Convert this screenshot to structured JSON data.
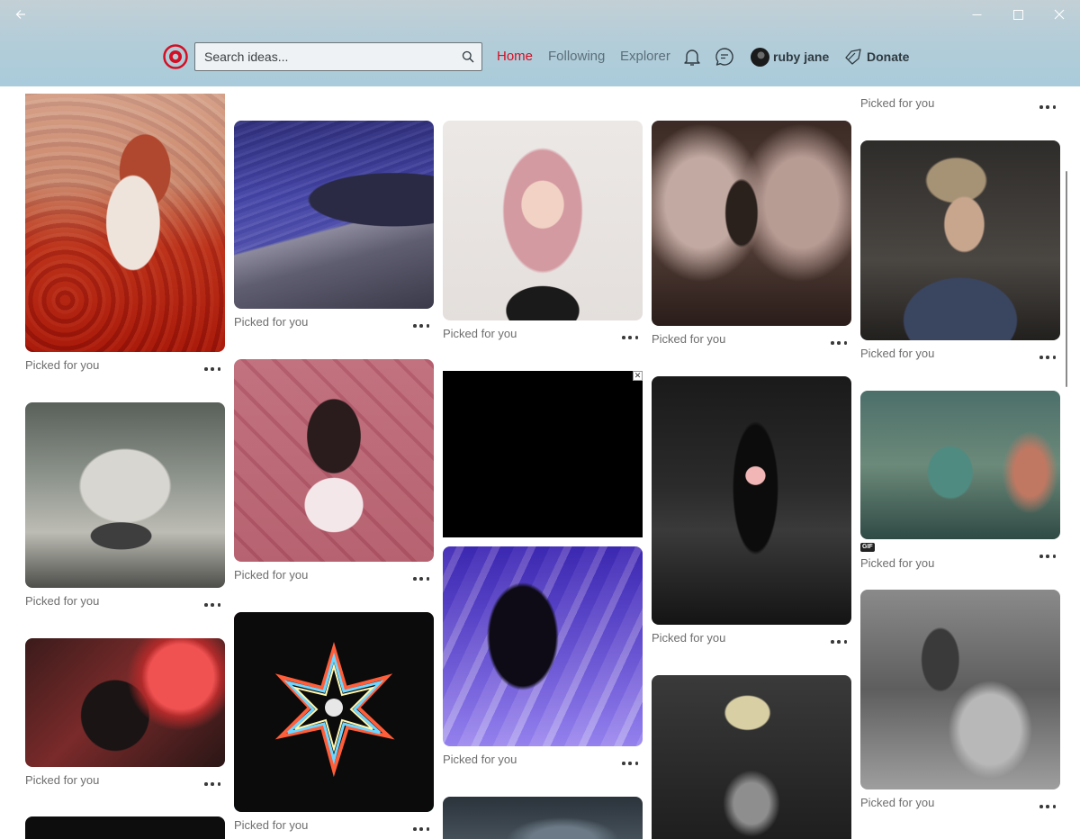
{
  "header": {
    "search_placeholder": "Search ideas...",
    "nav": {
      "home": "Home",
      "following": "Following",
      "explorer": "Explorer"
    },
    "user_name": "ruby jane",
    "donate_label": "Donate",
    "accent_color": "#d40f24"
  },
  "window": {
    "back_icon": "arrow-left-icon",
    "minimize_icon": "minimize-icon",
    "maximize_icon": "maximize-icon",
    "close_icon": "close-icon"
  },
  "pins": [
    {
      "label": "Picked for you",
      "image": "woman in red flower field photo"
    },
    {
      "label": "Picked for you",
      "image": "night beach waves photo"
    },
    {
      "label": "Picked for you",
      "image": "pink haired woman portrait"
    },
    {
      "label": "Picked for you",
      "image": "woman with white wings photo"
    },
    {
      "label": "Picked for you",
      "image": "blonde man in dark shirt"
    },
    {
      "label": "Picked for you",
      "image": "chain necklace crop top photo"
    },
    {
      "label": "Picked for you",
      "image": "woman in pink room photo"
    },
    {
      "label": "",
      "image": "black ad placeholder"
    },
    {
      "label": "Picked for you",
      "image": "woman in black outfit on stage"
    },
    {
      "label": "Picked for you",
      "image": "coral reef creature gif",
      "badge": "GIF"
    },
    {
      "label": "Picked for you",
      "image": "woman in red neon light"
    },
    {
      "label": "Picked for you",
      "image": "rainbow star light flare"
    },
    {
      "label": "Picked for you",
      "image": "silhouette in purple light"
    },
    {
      "label": "",
      "image": "blonde woman with hand gesture"
    },
    {
      "label": "Picked for you",
      "image": "shirtless man black and white"
    },
    {
      "label": "Picked for you",
      "image": "top partial pin"
    }
  ]
}
